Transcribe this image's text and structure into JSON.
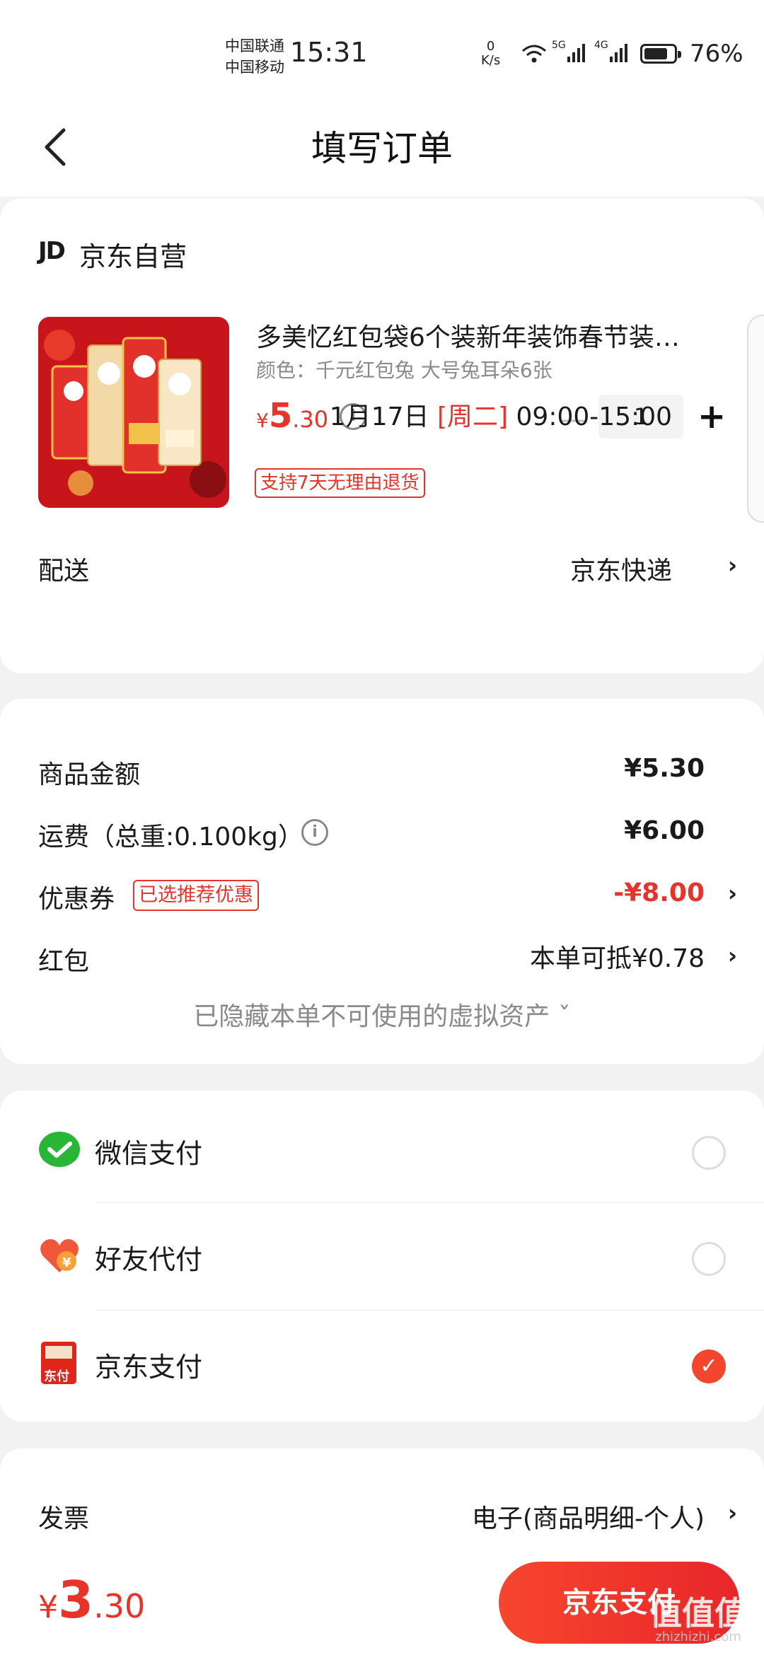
{
  "status_bar": {
    "carrier_1": "中国联通",
    "carrier_2": "中国移动",
    "time": "15:31",
    "net_speed_value": "0",
    "net_speed_unit": "K/s",
    "signal_1": "5G",
    "signal_2": "4G",
    "battery_percent": "76%"
  },
  "nav": {
    "title": "填写订单"
  },
  "shop": {
    "logo": "JD",
    "name": "京东自营"
  },
  "product": {
    "title": "多美忆红包袋6个装新年装饰春节装…",
    "spec": "颜色：千元红包兔 大号兔耳朵6张",
    "price_currency": "¥",
    "price_int": "5",
    "price_dec": ".30",
    "quantity": "1",
    "return_policy": "支持7天无理由退货"
  },
  "delivery": {
    "label": "配送",
    "carrier": "京东快递",
    "date": "1月17日",
    "weekday": "[周二]",
    "time_window": "09:00-15:00"
  },
  "summary": {
    "goods_label": "商品金额",
    "goods_value": "¥5.30",
    "shipping_label": "运费（总重:0.100kg）",
    "shipping_value": "¥6.00",
    "coupon_label": "优惠券",
    "coupon_tag": "已选推荐优惠",
    "coupon_value": "-¥8.00",
    "redpacket_label": "红包",
    "redpacket_value": "本单可抵¥0.78",
    "hidden_assets": "已隐藏本单不可使用的虚拟资产 ˇ"
  },
  "payment": {
    "methods": [
      {
        "label": "微信支付",
        "selected": false
      },
      {
        "label": "好友代付",
        "selected": false
      },
      {
        "label": "京东支付",
        "selected": true
      }
    ],
    "jd_icon_text": "东付",
    "friend_icon_text": "¥",
    "check_mark": "✓"
  },
  "invoice": {
    "label": "发票",
    "value": "电子(商品明细-个人)"
  },
  "footer": {
    "total_currency": "¥",
    "total_int": "3",
    "total_dec": ".30",
    "pay_button": "京东支付"
  },
  "watermark": {
    "text": "值值值",
    "url": "zhizhizhi.com"
  },
  "colors": {
    "accent": "#e8332b",
    "pay_button": "#f6462d",
    "wechat_green": "#29b636"
  }
}
